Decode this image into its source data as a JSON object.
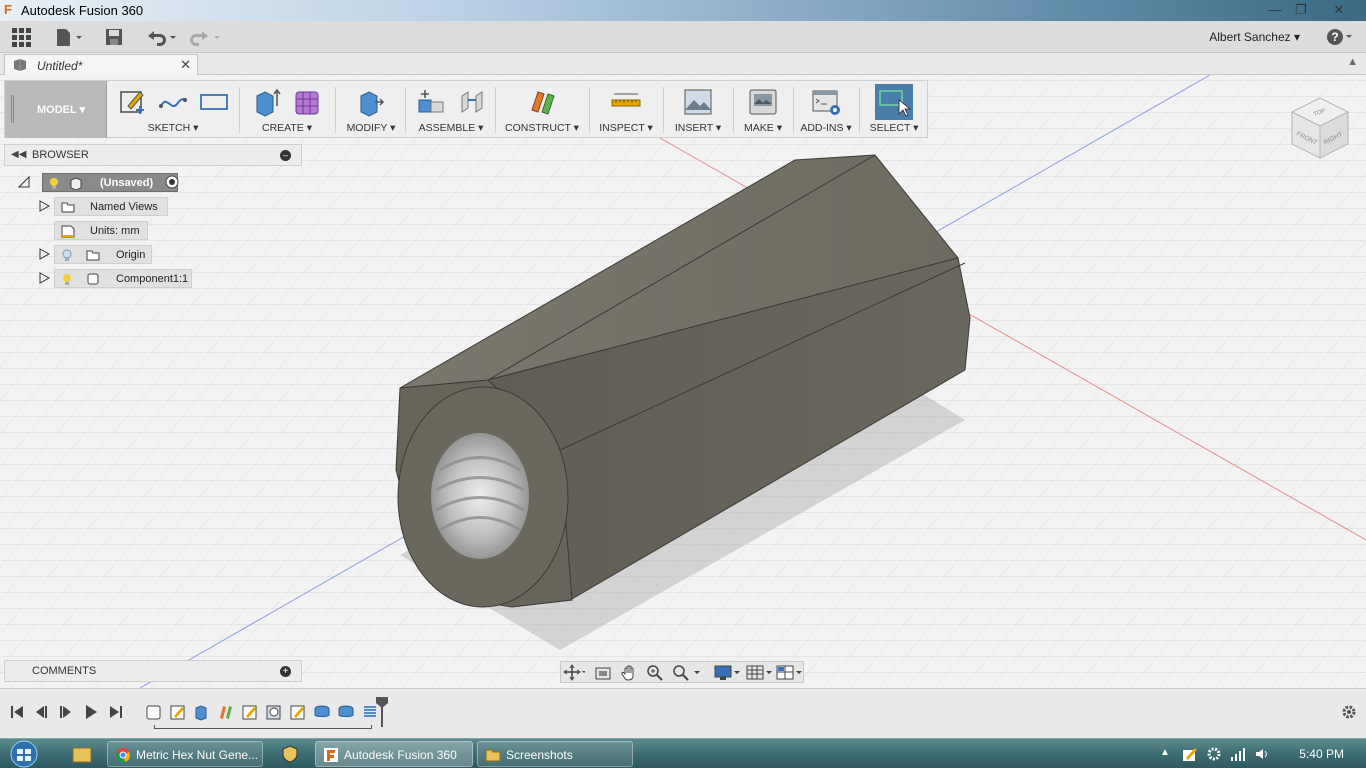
{
  "window": {
    "title": "Autodesk Fusion 360",
    "controls": [
      "minimize-icon",
      "restore-icon",
      "close-icon"
    ]
  },
  "quick_access": {
    "user": "Albert Sanchez",
    "help": "?"
  },
  "document_tab": {
    "label": "Untitled*"
  },
  "workspace": {
    "label": "MODEL"
  },
  "ribbon": {
    "groups": [
      {
        "label": "SKETCH"
      },
      {
        "label": "CREATE"
      },
      {
        "label": "MODIFY"
      },
      {
        "label": "ASSEMBLE"
      },
      {
        "label": "CONSTRUCT"
      },
      {
        "label": "INSPECT"
      },
      {
        "label": "INSERT"
      },
      {
        "label": "MAKE"
      },
      {
        "label": "ADD-INS"
      },
      {
        "label": "SELECT"
      }
    ]
  },
  "viewcube": {
    "faces": [
      "TOP",
      "FRONT",
      "RIGHT"
    ]
  },
  "browser": {
    "title": "BROWSER",
    "items": [
      {
        "label": "(Unsaved)"
      },
      {
        "label": "Named Views"
      },
      {
        "label": "Units: mm"
      },
      {
        "label": "Origin"
      },
      {
        "label": "Component1:1"
      }
    ]
  },
  "comments": {
    "title": "COMMENTS"
  },
  "taskbar": {
    "items": [
      {
        "label": "Metric Hex Nut Gene..."
      },
      {
        "label": "Autodesk Fusion 360"
      },
      {
        "label": "Screenshots"
      }
    ],
    "clock": "5:40 PM"
  },
  "colors": {
    "model_body": "#6e6c62",
    "selection_blue": "#4a7ea8",
    "brand_orange": "#e2661a"
  }
}
